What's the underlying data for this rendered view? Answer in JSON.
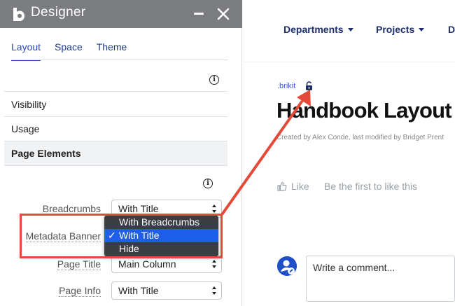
{
  "panel": {
    "title": "Designer",
    "tabs": [
      {
        "label": "Layout",
        "active": true
      },
      {
        "label": "Space",
        "active": false
      },
      {
        "label": "Theme",
        "active": false
      }
    ],
    "rows": {
      "visibility": "Visibility",
      "usage": "Usage",
      "page_elements": "Page Elements"
    },
    "fields": [
      {
        "label": "Breadcrumbs",
        "value": "With Title"
      },
      {
        "label": "Metadata Banner",
        "value": "With Title"
      },
      {
        "label": "Page Title",
        "value": "Main Column"
      },
      {
        "label": "Page Info",
        "value": "With Title"
      }
    ],
    "dropdown_options": [
      {
        "label": "With Breadcrumbs",
        "selected": false
      },
      {
        "label": "With Title",
        "selected": true
      },
      {
        "label": "Hide",
        "selected": false
      }
    ],
    "check_glyph": "✓"
  },
  "page": {
    "nav": [
      "Departments",
      "Projects",
      "D"
    ],
    "breadcrumb": ".brikit",
    "title": "Handbook Layout",
    "meta": "Created by Alex Conde, last modified by Bridget Prent",
    "like_label": "Like",
    "like_prompt": "Be the first to like this",
    "comment_placeholder": "Write a comment..."
  },
  "colors": {
    "titlebar": "#7a7c80",
    "accent": "#2a4ab8",
    "annotation": "#e34a3a",
    "dropdown_bg": "#3b3d40",
    "dropdown_selected": "#1f5ee9"
  },
  "icons": [
    "logo-icon",
    "minimize-icon",
    "close-icon",
    "info-icon",
    "chevron-updown-icon",
    "check-icon",
    "lock-icon",
    "thumbs-up-icon",
    "avatar-icon"
  ]
}
